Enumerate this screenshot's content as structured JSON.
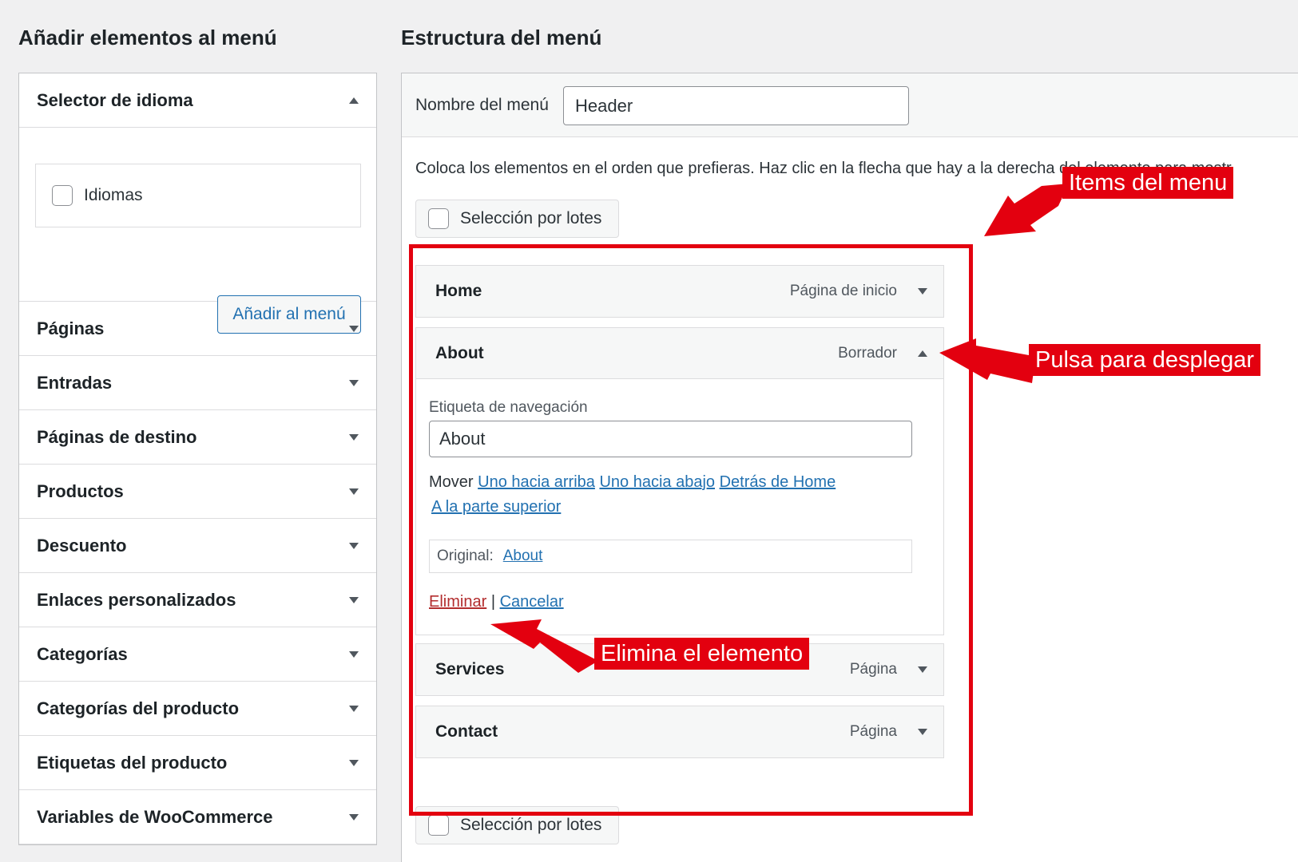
{
  "left": {
    "title": "Añadir elementos al menú",
    "language_selector": {
      "title": "Selector de idioma",
      "checkbox_label": "Idiomas",
      "add_button": "Añadir al menú"
    },
    "accordion": [
      {
        "label": "Páginas"
      },
      {
        "label": "Entradas"
      },
      {
        "label": "Páginas de destino"
      },
      {
        "label": "Productos"
      },
      {
        "label": "Descuento"
      },
      {
        "label": "Enlaces personalizados"
      },
      {
        "label": "Categorías"
      },
      {
        "label": "Categorías del producto"
      },
      {
        "label": "Etiquetas del producto"
      },
      {
        "label": "Variables de WooCommerce"
      }
    ]
  },
  "right": {
    "title": "Estructura del menú",
    "menu_name_label": "Nombre del menú",
    "menu_name_value": "Header",
    "instructions": "Coloca los elementos en el orden que prefieras. Haz clic en la flecha que hay a la derecha del elemento para mostr",
    "bulk_select": "Selección por lotes",
    "items": [
      {
        "title": "Home",
        "type": "Página de inicio"
      },
      {
        "title": "About",
        "type": "Borrador"
      },
      {
        "title": "Services",
        "type": "Página"
      },
      {
        "title": "Contact",
        "type": "Página"
      }
    ],
    "about_settings": {
      "nav_label": "Etiqueta de navegación",
      "nav_value": "About",
      "move_label": "Mover",
      "move_up": "Uno hacia arriba",
      "move_down": "Uno hacia abajo",
      "move_after": "Detrás de Home",
      "move_top": "A la parte superior",
      "original_label": "Original:",
      "original_link": "About",
      "delete": "Eliminar",
      "separator": "|",
      "cancel": "Cancelar"
    }
  },
  "annotations": {
    "items_label": "Items del menu",
    "expand_label": "Pulsa para desplegar",
    "delete_label": "Elimina el elemento",
    "color": "#e3000f"
  }
}
